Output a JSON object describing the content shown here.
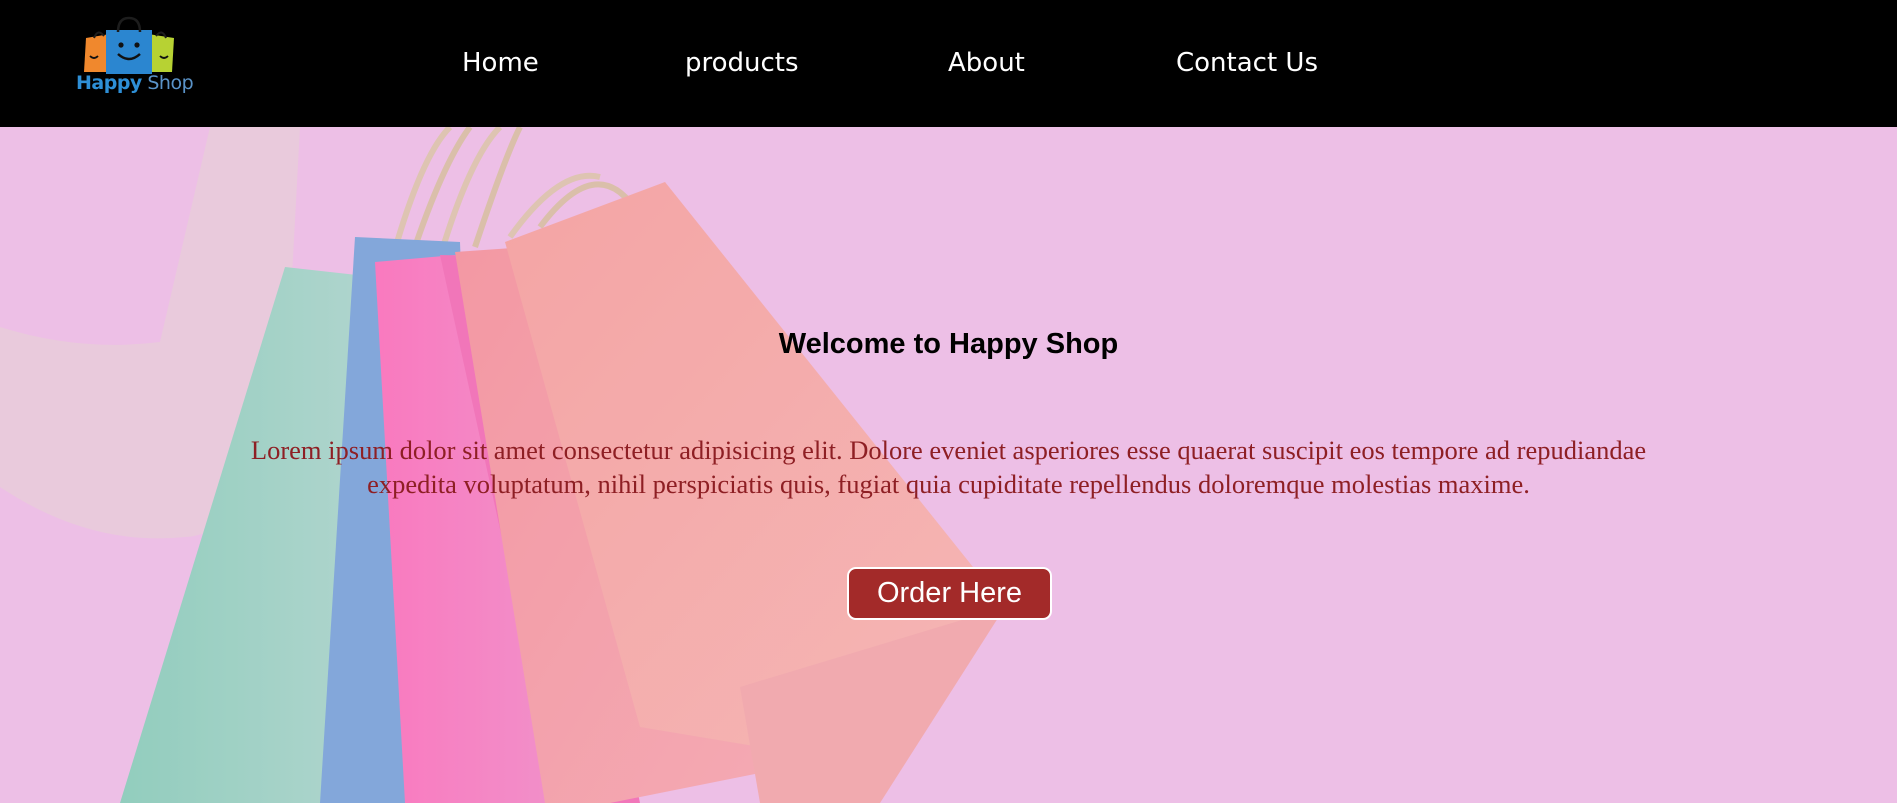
{
  "brand": {
    "name_part1": "Happy",
    "name_part2": " Shop",
    "bag_colors": [
      "#f0882d",
      "#2b86d0",
      "#b7d233"
    ]
  },
  "nav": {
    "items": [
      {
        "label": "Home"
      },
      {
        "label": "products"
      },
      {
        "label": "About"
      },
      {
        "label": "Contact Us"
      }
    ]
  },
  "hero": {
    "title": "Welcome to Happy Shop",
    "text": "Lorem ipsum dolor sit amet consectetur adipisicing elit. Dolore eveniet asperiores esse quaerat suscipit eos tempore ad repudiandae expedita voluptatum, nihil perspiciatis quis, fugiat quia cupiditate repellendus doloremque molestias maxime.",
    "cta_label": "Order Here",
    "background_color": "#eebfe6",
    "cta_color": "#a32a29"
  }
}
